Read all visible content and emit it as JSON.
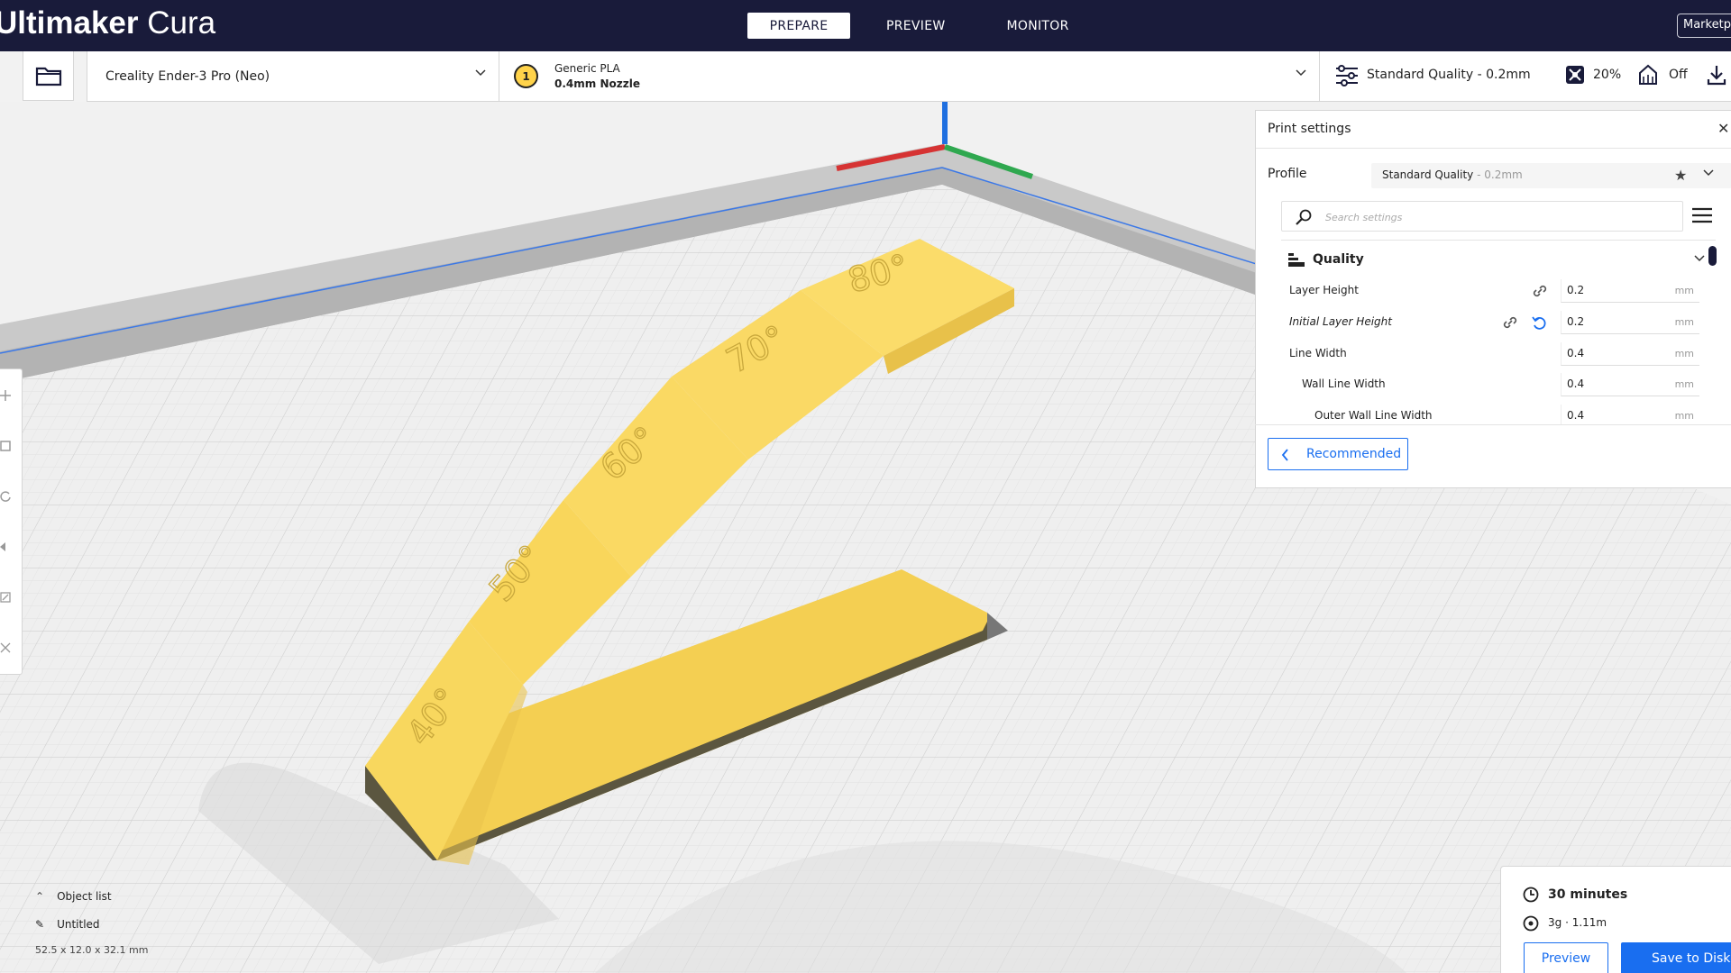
{
  "app": {
    "title_bold": "Ultimaker",
    "title_light": " Cura"
  },
  "stages": [
    {
      "label": "PREPARE",
      "active": true
    },
    {
      "label": "PREVIEW",
      "active": false
    },
    {
      "label": "MONITOR",
      "active": false
    }
  ],
  "marketplace_label": "Marketplace",
  "printer": {
    "name": "Creality Ender-3 Pro (Neo)"
  },
  "extruder": {
    "index": "1",
    "material": "Generic PLA",
    "nozzle": "0.4mm Nozzle"
  },
  "print_setup": {
    "quality_label": "Standard Quality - 0.2mm",
    "infill": "20%",
    "support": "Off"
  },
  "print_settings": {
    "title": "Print settings",
    "profile_label": "Profile",
    "profile_name": "Standard Quality",
    "profile_sub": " - 0.2mm",
    "search_placeholder": "Search settings",
    "category": "Quality",
    "settings": [
      {
        "label": "Layer Height",
        "value": "0.2",
        "unit": "mm"
      },
      {
        "label": "Initial Layer Height",
        "value": "0.2",
        "unit": "mm"
      },
      {
        "label": "Line Width",
        "value": "0.4",
        "unit": "mm"
      },
      {
        "label": "Wall Line Width",
        "value": "0.4",
        "unit": "mm"
      },
      {
        "label": "Outer Wall Line Width",
        "value": "0.4",
        "unit": "mm"
      }
    ],
    "recommended_label": "Recommended"
  },
  "model_labels": [
    "80°",
    "70°",
    "60°",
    "50°",
    "40°"
  ],
  "object_list": {
    "toggle_label": "Object list",
    "object_name": "Untitled",
    "dimensions": "52.5 x 12.0 x 32.1 mm"
  },
  "action_panel": {
    "print_time": "30 minutes",
    "material_estimate": "3g · 1.11m",
    "preview_label": "Preview",
    "save_label": "Save to Disk"
  },
  "colors": {
    "header_bg": "#191b3a",
    "accent_blue": "#196ef0",
    "model_yellow": "#f9d65b",
    "extruder_yellow": "#ffd34a",
    "axis_x": "#d63333",
    "axis_y": "#2fa84f",
    "axis_z": "#1f6fe0"
  }
}
